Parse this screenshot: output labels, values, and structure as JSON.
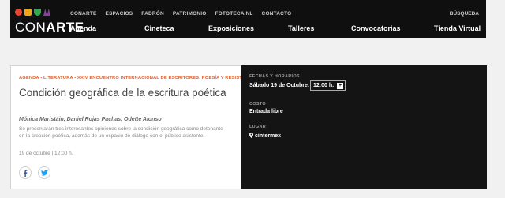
{
  "header": {
    "logo_text_light": "CON",
    "logo_text_bold": "ARTE",
    "logo_colors": [
      "#e8452c",
      "#f2a31b",
      "#2fa84f",
      "#8b3fa0"
    ],
    "top_nav": [
      "CONARTE",
      "ESPACIOS",
      "FADRÓN",
      "PATRIMONIO",
      "FOTOTECA NL",
      "CONTACTO"
    ],
    "search_label": "BÚSQUEDA",
    "main_nav": [
      "Agenda",
      "Cineteca",
      "Exposiciones",
      "Talleres",
      "Convocatorias",
      "Tienda Virtual"
    ]
  },
  "event": {
    "breadcrumb": "AGENDA • LITERATURA • XXIV ENCUENTRO INTERNACIONAL DE ESCRITORES: POESÍA Y RESISTENCIA",
    "title": "Condición geográfica de la escritura poética",
    "authors": "Mónica Maristáin, Daniel Rojas Pachas, Odette Alonso",
    "description": "Se presentarán tres interesantes opiniones sobre la condición geográfica como detonante en la creación poética, además de un espacio de diálogo con el público asistente.",
    "date_time": "19 de octubre | 12:00 h.",
    "accent_color": "#e3622e"
  },
  "social": {
    "facebook_icon": "facebook-icon",
    "twitter_icon": "twitter-icon",
    "facebook_color": "#3b5998",
    "twitter_color": "#1da1f2"
  },
  "details": {
    "schedule_label": "FECHAS Y HORARIOS",
    "schedule_day": "Sábado 19 de Octubre:",
    "schedule_time": "12:00 h.",
    "schedule_add": "+",
    "cost_label": "COSTO",
    "cost_value": "Entrada libre",
    "place_label": "LUGAR",
    "place_value": "cintermex"
  }
}
